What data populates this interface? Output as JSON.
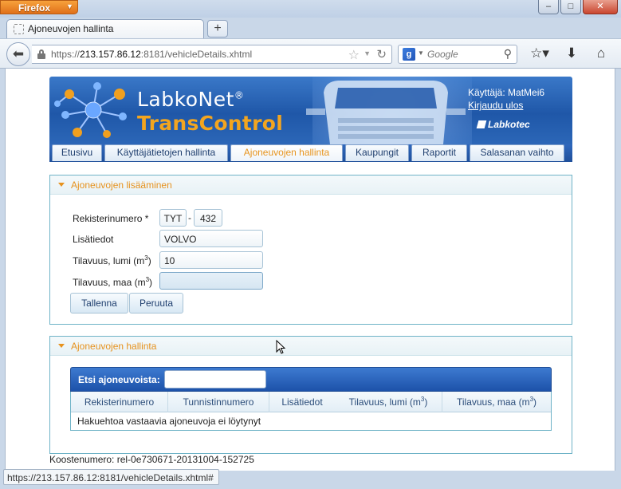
{
  "browser": {
    "app_button": "Firefox",
    "window_buttons": [
      "–",
      "□",
      "✕"
    ],
    "tab_title": "Ajoneuvojen hallinta",
    "new_tab": "+",
    "url_prefix": "https://",
    "url_host": "213.157.86.12",
    "url_rest": ":8181/vehicleDetails.xhtml",
    "search_engine": "g",
    "search_placeholder": "Google",
    "status_url": "https://213.157.86.12:8181/vehicleDetails.xhtml#"
  },
  "header": {
    "brand_line1": "LabkoNet",
    "brand_reg": "®",
    "brand_line2": "TransControl",
    "user_label": "Käyttäjä: MatMei6",
    "logout_link": "Kirjaudu ulos",
    "company_logo": "Labkotec"
  },
  "menu": [
    {
      "label": "Etusivu",
      "active": false
    },
    {
      "label": "Käyttäjätietojen hallinta",
      "active": false
    },
    {
      "label": "Ajoneuvojen hallinta",
      "active": true
    },
    {
      "label": "Kaupungit",
      "active": false
    },
    {
      "label": "Raportit",
      "active": false
    },
    {
      "label": "Salasanan vaihto",
      "active": false
    }
  ],
  "add_panel": {
    "title": "Ajoneuvojen lisääminen",
    "reg_label": "Rekisterinumero *",
    "reg_part1": "TYT",
    "reg_sep": "-",
    "reg_part2": "432",
    "info_label": "Lisätiedot",
    "info_value": "VOLVO",
    "vol_snow_label": "Tilavuus, lumi (m",
    "vol_snow_value": "10",
    "vol_ground_label": "Tilavuus, maa (m",
    "vol_ground_value": "",
    "unit_exp": "3",
    "unit_close": ")",
    "save_button": "Tallenna",
    "cancel_button": "Peruuta"
  },
  "manage_panel": {
    "title": "Ajoneuvojen hallinta",
    "search_label": "Etsi ajoneuvoista:",
    "search_value": "",
    "columns": [
      "Rekisterinumero",
      "Tunnistinnumero",
      "Lisätiedot",
      "Tilavuus, lumi (m",
      "Tilavuus, maa (m"
    ],
    "col_exp": "3",
    "col_close": ")",
    "empty_message": "Hakuehtoa vastaavia ajoneuvoja ei löytynyt"
  },
  "footer": {
    "build": "Koostenumero: rel-0e730671-20131004-152725"
  },
  "colors": {
    "accent_orange": "#e6921e",
    "banner_blue": "#1f57a8",
    "panel_border": "#6fb3c7"
  }
}
